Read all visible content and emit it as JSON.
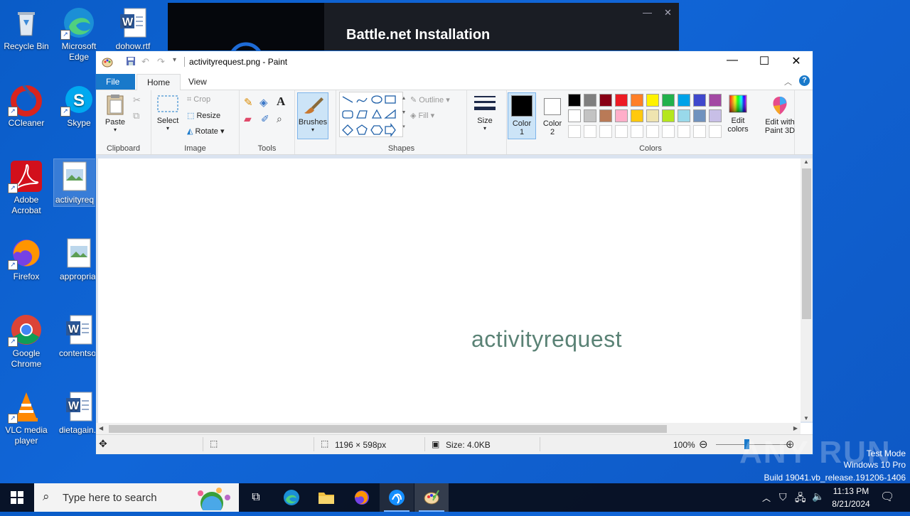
{
  "desktop": {
    "icons": [
      {
        "label": "Recycle Bin",
        "icon": "recycle-bin-icon"
      },
      {
        "label": "Microsoft Edge",
        "icon": "edge-icon"
      },
      {
        "label": "dohow.rtf",
        "icon": "word-document-icon"
      },
      {
        "label": "CCleaner",
        "icon": "ccleaner-icon"
      },
      {
        "label": "Skype",
        "icon": "skype-icon"
      },
      {
        "label": "Adobe Acrobat",
        "icon": "acrobat-icon"
      },
      {
        "label": "activityreq",
        "icon": "image-file-icon"
      },
      {
        "label": "Firefox",
        "icon": "firefox-icon"
      },
      {
        "label": "appropriat",
        "icon": "image-file-icon"
      },
      {
        "label": "Google Chrome",
        "icon": "chrome-icon"
      },
      {
        "label": "contentsor",
        "icon": "word-document-icon"
      },
      {
        "label": "VLC media player",
        "icon": "vlc-icon"
      },
      {
        "label": "dietagain.r",
        "icon": "word-document-icon"
      }
    ]
  },
  "battlenet": {
    "title": "Battle.net Installation"
  },
  "paint": {
    "window_title": "activityrequest.png - Paint",
    "tabs": {
      "file": "File",
      "home": "Home",
      "view": "View"
    },
    "clipboard": {
      "paste": "Paste",
      "group": "Clipboard"
    },
    "image": {
      "select": "Select",
      "crop": "Crop",
      "resize": "Resize",
      "rotate": "Rotate",
      "group": "Image"
    },
    "tools": {
      "group": "Tools"
    },
    "brushes": {
      "label": "Brushes"
    },
    "shapes": {
      "outline": "Outline",
      "fill": "Fill",
      "group": "Shapes"
    },
    "size": {
      "label": "Size"
    },
    "colors": {
      "color1_label": "Color",
      "color1_num": "1",
      "color2_label": "Color",
      "color2_num": "2",
      "group": "Colors",
      "edit_label": "Edit",
      "edit_label2": "colors",
      "color1": "#000000",
      "color2": "#ffffff",
      "palette_row1": [
        "#000000",
        "#7f7f7f",
        "#880015",
        "#ed1c24",
        "#ff7f27",
        "#fff200",
        "#22b14c",
        "#00a2e8",
        "#3f48cc",
        "#a349a4"
      ],
      "palette_row2": [
        "#ffffff",
        "#c3c3c3",
        "#b97a57",
        "#ffaec9",
        "#ffc90e",
        "#efe4b0",
        "#b5e61d",
        "#99d9ea",
        "#7092be",
        "#c8bfe7"
      ]
    },
    "paint3d": {
      "line1": "Edit with",
      "line2": "Paint 3D"
    },
    "canvas_text": "activityrequest",
    "status": {
      "dimensions": "1196 × 598px",
      "size": "Size: 4.0KB",
      "zoom": "100%"
    }
  },
  "taskbar": {
    "search_placeholder": "Type here to search",
    "time": "11:13 PM",
    "date": "8/21/2024"
  },
  "watermark": {
    "line1": "Test Mode",
    "line2": "Windows 10 Pro",
    "line3": "Build 19041.vb_release.191206-1406",
    "brand": "ANY RUN"
  }
}
